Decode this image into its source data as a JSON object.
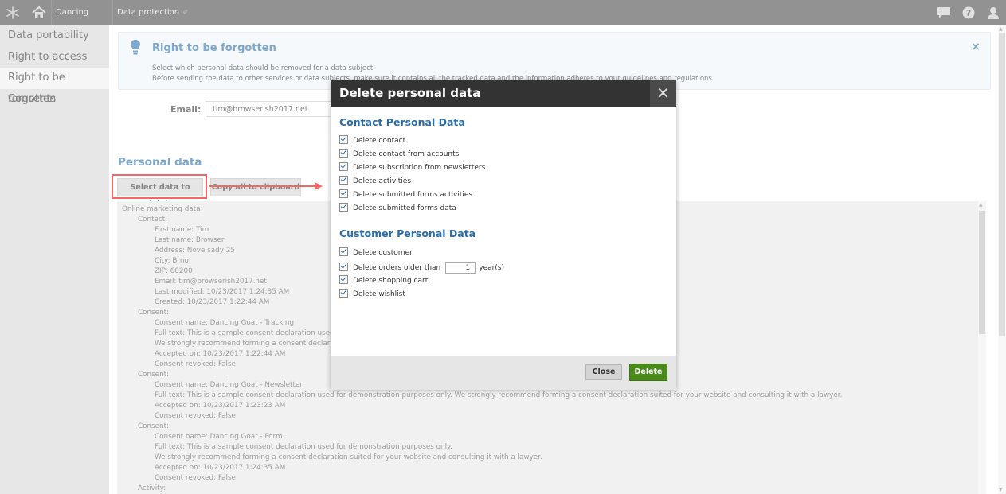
{
  "topbar": {
    "site_name": "Dancing Goat",
    "site_caret": "◢",
    "app_name": "Data protection",
    "app_pin": "✐"
  },
  "leftnav": {
    "items": [
      {
        "label": "Data portability",
        "active": false
      },
      {
        "label": "Right to access",
        "active": false
      },
      {
        "label": "Right to be forgotten",
        "active": true
      },
      {
        "label": "Consents",
        "active": false
      }
    ]
  },
  "info": {
    "title": "Right to be forgotten",
    "line1": "Select which personal data should be removed for a data subject.",
    "line2": "Before sending the data to other services or data subjects, make sure it contains all the tracked data and the information adheres to your guidelines and regulations.",
    "close": "×"
  },
  "form": {
    "email_label": "Email:",
    "email_value": "tim@browserish2017.net"
  },
  "personal": {
    "heading": "Personal data",
    "select_button": "Select data to delete",
    "copy_button": "Copy all to clipboard",
    "lines": [
      "Online marketing data:",
      "Contact:",
      "First name: Tim",
      "Last name: Browser",
      "Address: Nove sady 25",
      "City: Brno",
      "ZIP: 60200",
      "Email: tim@browserish2017.net",
      "Last modified: 10/23/2017 1:24:35 AM",
      "Created: 10/23/2017 1:22:44 AM",
      "Consent:",
      "Consent name: Dancing Goat - Tracking",
      "Full text: This is a sample consent declaration used for",
      "We strongly recommend forming a consent declaratio",
      "Accepted on: 10/23/2017 1:22:44 AM",
      "Consent revoked: False",
      "Consent:",
      "Consent name: Dancing Goat - Newsletter",
      "Full text: This is a sample consent declaration used for demonstration purposes only. We strongly recommend forming a consent declaration suited for your website and consulting it with a lawyer.",
      "Accepted on: 10/23/2017 1:23:23 AM",
      "Consent revoked: False",
      "Consent:",
      "Consent name: Dancing Goat - Form",
      "Full text: This is a sample consent declaration used for demonstration purposes only.",
      "We strongly recommend forming a consent declaration suited for your website and consulting it with a lawyer.",
      "Accepted on: 10/23/2017 1:24:35 AM",
      "Consent revoked: False",
      "Activity:"
    ]
  },
  "modal": {
    "title": "Delete personal data",
    "close": "✕",
    "contact_section": "Contact Personal Data",
    "contact_options": [
      "Delete contact",
      "Delete contact from accounts",
      "Delete subscription from newsletters",
      "Delete activities",
      "Delete submitted forms activities",
      "Delete submitted forms data"
    ],
    "customer_section": "Customer Personal Data",
    "customer_option_1": "Delete customer",
    "orders_label": "Delete orders older than",
    "orders_years": "1",
    "orders_unit": "year(s)",
    "customer_option_3": "Delete shopping cart",
    "customer_option_4": "Delete wishlist",
    "close_button": "Close",
    "delete_button": "Delete"
  },
  "colors": {
    "accent": "#2b6da8",
    "topbar": "#4a4a4a",
    "delete_button": "#4a8a1a",
    "highlight": "#ee0000"
  }
}
